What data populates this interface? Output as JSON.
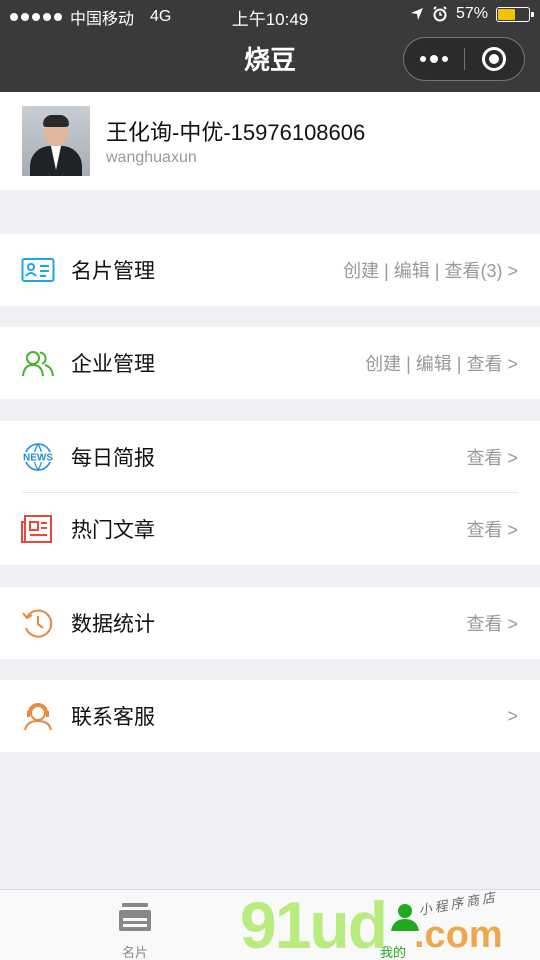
{
  "status_bar": {
    "carrier": "中国移动",
    "network": "4G",
    "time": "上午10:49",
    "battery_percent": "57%",
    "battery_level": 0.57
  },
  "nav": {
    "title": "烧豆"
  },
  "profile": {
    "name": "王化询-中优-15976108606",
    "username": "wanghuaxun"
  },
  "menu": {
    "card_manage": {
      "label": "名片管理",
      "actions": "创建 | 编辑 | 查看(3) >",
      "icon": "business-card-icon",
      "color": "#1aa6e8"
    },
    "company_manage": {
      "label": "企业管理",
      "actions": "创建 | 编辑 | 查看 >",
      "icon": "users-icon",
      "color": "#41b62b"
    },
    "daily_news": {
      "label": "每日简报",
      "actions": "查看 >",
      "icon": "news-globe-icon",
      "icon_text": "NEWS",
      "color": "#1a8fd8"
    },
    "hot_articles": {
      "label": "热门文章",
      "actions": "查看 >",
      "icon": "newspaper-icon",
      "color": "#e8483a"
    },
    "statistics": {
      "label": "数据统计",
      "actions": "查看 >",
      "icon": "history-clock-icon",
      "color": "#e8873a"
    },
    "customer_service": {
      "label": "联系客服",
      "actions": ">",
      "icon": "headset-agent-icon",
      "color": "#e8873a"
    }
  },
  "tabbar": {
    "tabs": [
      {
        "label": "名片",
        "icon": "card-stack-icon"
      },
      {
        "label": "我的",
        "icon": "user-icon"
      }
    ]
  },
  "watermark": {
    "brand": "91ud",
    "domain": ".com",
    "tagline": "小程序商店"
  }
}
